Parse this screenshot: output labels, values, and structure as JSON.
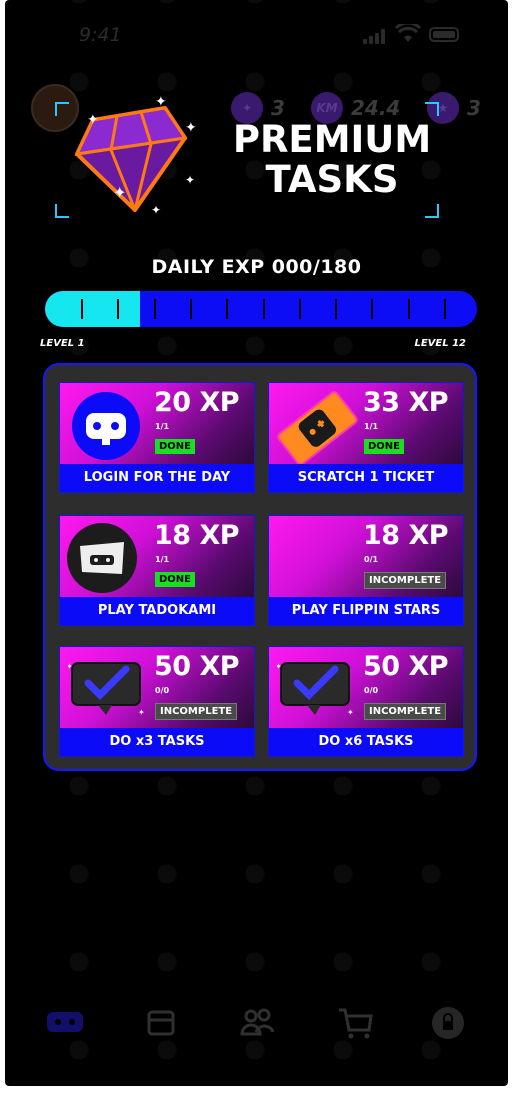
{
  "status": {
    "time": "9:41"
  },
  "top_stats": [
    {
      "icon": "ticket-icon",
      "value": "3"
    },
    {
      "icon": "km-coin-icon",
      "label": "KM",
      "value": "24.4"
    },
    {
      "icon": "stars-icon",
      "value": "3"
    }
  ],
  "hero": {
    "title_line1": "PREMIUM",
    "title_line2": "TASKS"
  },
  "daily_exp": {
    "label": "DAILY EXP 000/180",
    "progress": 0.22,
    "ticks": 11
  },
  "levels": {
    "start": "LEVEL 1",
    "end": "LEVEL 12"
  },
  "tasks": [
    {
      "xp": "20 XP",
      "progress": "1/1",
      "status": "DONE",
      "label": "LOGIN FOR THE DAY",
      "icon": "controller-icon"
    },
    {
      "xp": "33 XP",
      "progress": "1/1",
      "status": "DONE",
      "label": "SCRATCH 1 TICKET",
      "icon": "scratch-ticket-icon"
    },
    {
      "xp": "18 XP",
      "progress": "1/1",
      "status": "DONE",
      "label": "PLAY TADOKAMI",
      "icon": "tadokami-icon"
    },
    {
      "xp": "18 XP",
      "progress": "0/1",
      "status": "INCOMPLETE",
      "label": "PLAY FLIPPIN STARS",
      "icon": ""
    },
    {
      "xp": "50 XP",
      "progress": "0/0",
      "status": "INCOMPLETE",
      "label": "DO x3 TASKS",
      "icon": "checkmark-bubble-icon"
    },
    {
      "xp": "50 XP",
      "progress": "0/0",
      "status": "INCOMPLETE",
      "label": "DO x6 TASKS",
      "icon": "checkmark-bubble-icon"
    }
  ],
  "nav": [
    {
      "icon": "gamepad-icon",
      "active": true
    },
    {
      "icon": "chest-icon"
    },
    {
      "icon": "friends-icon"
    },
    {
      "icon": "cart-icon"
    },
    {
      "icon": "lock-icon"
    }
  ],
  "colors": {
    "accent_blue": "#0b0bf8",
    "cyan": "#16e6f0",
    "magenta": "#ff19ef",
    "done_green": "#18e020"
  }
}
